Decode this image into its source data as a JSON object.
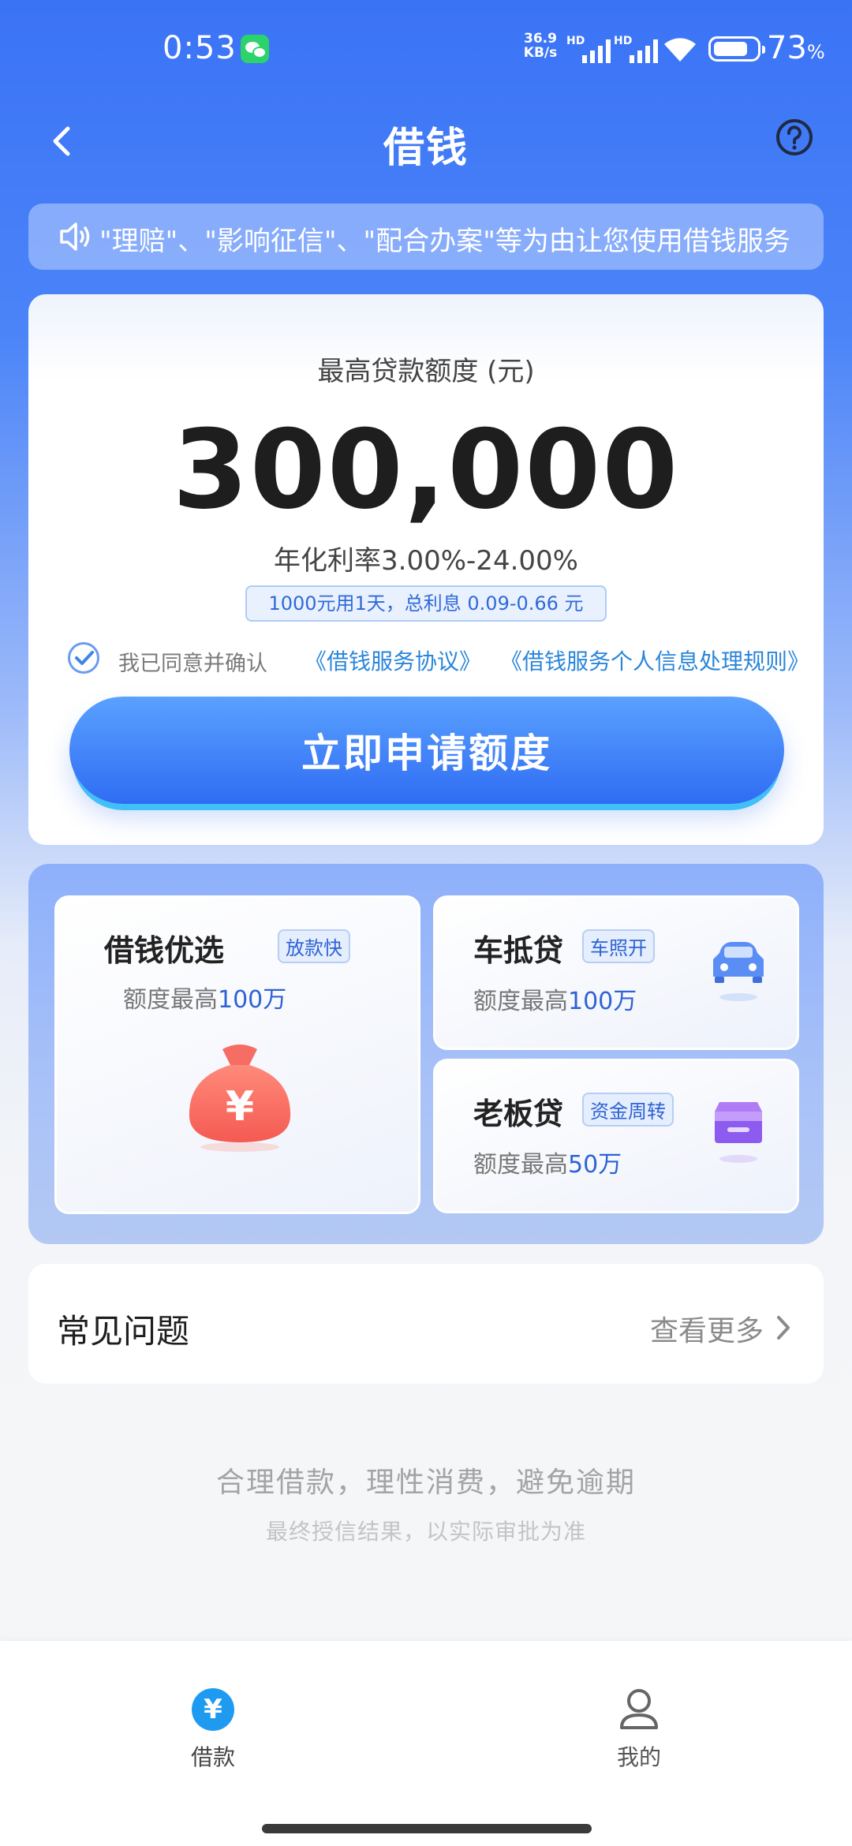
{
  "status_bar": {
    "time": "0:53",
    "net_speed_value": "36.9",
    "net_speed_unit": "KB/s",
    "sim1_label": "HD",
    "sim2_label": "HD",
    "battery_percent": "73",
    "battery_unit": "%"
  },
  "header": {
    "title": "借钱"
  },
  "notice": {
    "text": "\"理赔\"、\"影响征信\"、\"配合办案\"等为由让您使用借钱服务"
  },
  "credit": {
    "limit_label": "最高贷款额度 (元)",
    "limit_amount": "300,000",
    "rate_text": "年化利率3.00%-24.00%",
    "interest_example": "1000元用1天，总利息 0.09-0.66 元",
    "agree_prefix": "我已同意并确认",
    "agreement_link_1": "《借钱服务协议》",
    "agreement_link_2": "《借钱服务个人信息处理规则》",
    "agree_checked": true,
    "apply_button_label": "立即申请额度"
  },
  "products": [
    {
      "name": "借钱优选",
      "tag": "放款快",
      "desc_prefix": "额度最高",
      "desc_amount": "100万",
      "icon": "money-bag-icon"
    },
    {
      "name": "车抵贷",
      "tag": "车照开",
      "desc_prefix": "额度最高",
      "desc_amount": "100万",
      "icon": "car-icon"
    },
    {
      "name": "老板贷",
      "tag": "资金周转",
      "desc_prefix": "额度最高",
      "desc_amount": "50万",
      "icon": "shop-icon"
    }
  ],
  "faq": {
    "title": "常见问题",
    "more_label": "查看更多"
  },
  "footer": {
    "slogan": "合理借款，理性消费，避免逾期",
    "sub_slogan": "最终授信结果，以实际审批为准"
  },
  "bottom_nav": [
    {
      "label": "借款",
      "icon": "yen-icon",
      "active": true
    },
    {
      "label": "我的",
      "icon": "user-icon",
      "active": false
    }
  ],
  "colors": {
    "primary_blue": "#3a73f5",
    "link_blue": "#2a86d9",
    "tag_blue": "#2f62d4"
  }
}
